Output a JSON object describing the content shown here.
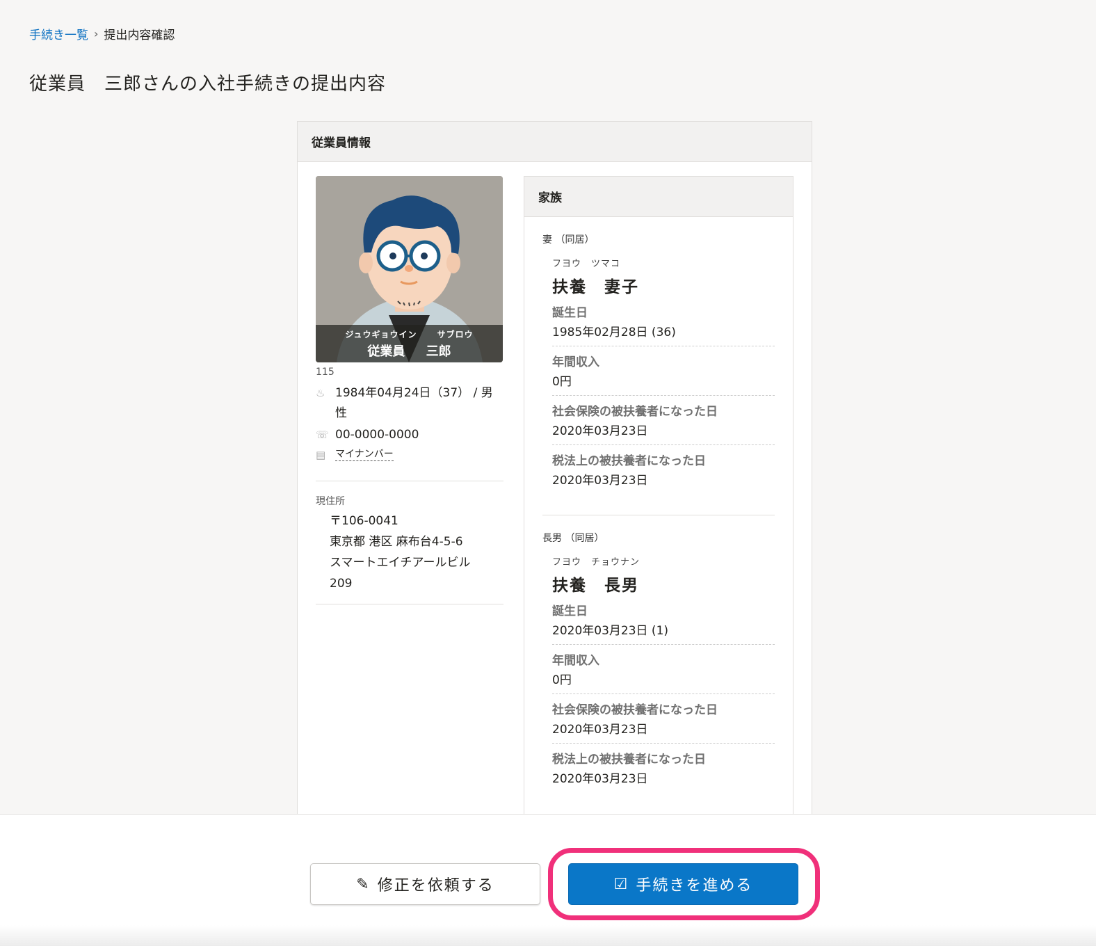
{
  "breadcrumb": {
    "link": "手続き一覧",
    "current": "提出内容確認"
  },
  "page_title": "従業員　三郎さんの入社手続きの提出内容",
  "panel": {
    "title": "従業員情報",
    "employee": {
      "kana_last": "ジュウギョウイン",
      "kana_first": "サブロウ",
      "name_last": "従業員",
      "name_first": "三郎",
      "number": "115",
      "birth": "1984年04月24日（37） / 男性",
      "phone": "00-0000-0000",
      "mynumber_link": "マイナンバー",
      "address_label": "現住所",
      "address": {
        "postal": "〒106-0041",
        "line1": "東京都 港区 麻布台4-5-6",
        "line2": "スマートエイチアールビル",
        "line3": "209"
      }
    },
    "family": {
      "title": "家族",
      "members": [
        {
          "relation": "妻 （同居）",
          "kana": "フヨウ　ツマコ",
          "name": "扶養　妻子",
          "fields": [
            {
              "label": "誕生日",
              "value": "1985年02月28日 (36)"
            },
            {
              "label": "年間収入",
              "value": "0円"
            },
            {
              "label": "社会保険の被扶養者になった日",
              "value": "2020年03月23日"
            },
            {
              "label": "税法上の被扶養者になった日",
              "value": "2020年03月23日"
            }
          ]
        },
        {
          "relation": "長男 （同居）",
          "kana": "フヨウ　チョウナン",
          "name": "扶養　長男",
          "fields": [
            {
              "label": "誕生日",
              "value": "2020年03月23日 (1)"
            },
            {
              "label": "年間収入",
              "value": "0円"
            },
            {
              "label": "社会保険の被扶養者になった日",
              "value": "2020年03月23日"
            },
            {
              "label": "税法上の被扶養者になった日",
              "value": "2020年03月23日"
            }
          ]
        }
      ]
    }
  },
  "footer": {
    "request_fix_label": "修正を依頼する",
    "proceed_label": "手続きを進める"
  },
  "colors": {
    "primary": "#0a77c8",
    "highlight": "#f0307a",
    "link": "#0a6fc1"
  },
  "icons": [
    "chevron-right-icon",
    "cake-icon",
    "phone-icon",
    "id-card-icon",
    "pencil-icon",
    "edit-icon"
  ]
}
